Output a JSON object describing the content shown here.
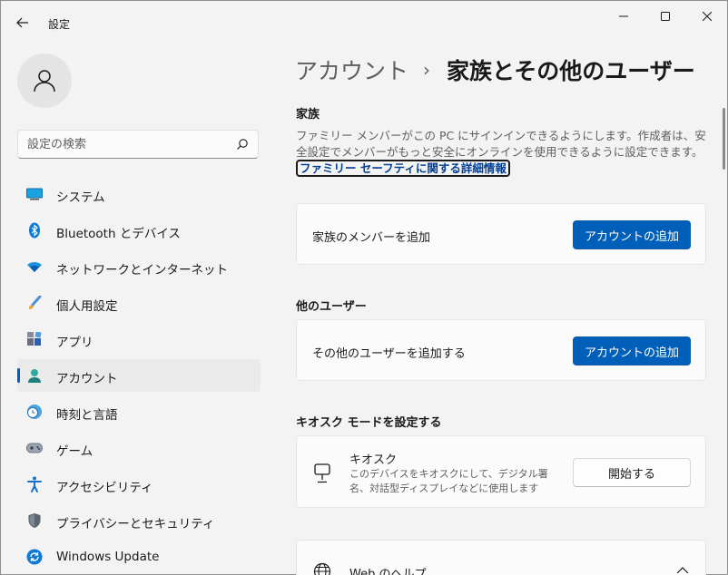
{
  "window": {
    "title": "設定",
    "controls": [
      "minimize-icon",
      "maximize-icon",
      "close-icon"
    ]
  },
  "sidebar": {
    "search_placeholder": "設定の検索",
    "items": [
      {
        "label": "システム",
        "icon": "system-icon"
      },
      {
        "label": "Bluetooth とデバイス",
        "icon": "bluetooth-icon"
      },
      {
        "label": "ネットワークとインターネット",
        "icon": "wifi-icon"
      },
      {
        "label": "個人用設定",
        "icon": "brush-icon"
      },
      {
        "label": "アプリ",
        "icon": "apps-icon"
      },
      {
        "label": "アカウント",
        "icon": "account-icon",
        "active": true
      },
      {
        "label": "時刻と言語",
        "icon": "time-language-icon"
      },
      {
        "label": "ゲーム",
        "icon": "gamepad-icon"
      },
      {
        "label": "アクセシビリティ",
        "icon": "accessibility-icon"
      },
      {
        "label": "プライバシーとセキュリティ",
        "icon": "shield-icon"
      },
      {
        "label": "Windows Update",
        "icon": "windows-update-icon"
      }
    ]
  },
  "breadcrumb": {
    "parent": "アカウント",
    "separator": "›",
    "current": "家族とその他のユーザー"
  },
  "family": {
    "title": "家族",
    "description": "ファミリー メンバーがこの PC にサインインできるようにします。作成者は、安全設定でメンバーがもっと安全にオンラインを使用できるように設定できます。",
    "link": "ファミリー セーフティに関する詳細情報",
    "card_label": "家族のメンバーを追加",
    "button": "アカウントの追加"
  },
  "other_users": {
    "title": "他のユーザー",
    "card_label": "その他のユーザーを追加する",
    "button": "アカウントの追加"
  },
  "kiosk": {
    "title": "キオスク モードを設定する",
    "card_title": "キオスク",
    "card_desc": "このデバイスをキオスクにして、デジタル署名、対話型ディスプレイなどに使用します",
    "button": "開始する"
  },
  "web_help": {
    "title": "Web のヘルプ"
  },
  "colors": {
    "accent": "#005fb8",
    "background": "#f3f3f3",
    "card": "#fbfbfb"
  }
}
